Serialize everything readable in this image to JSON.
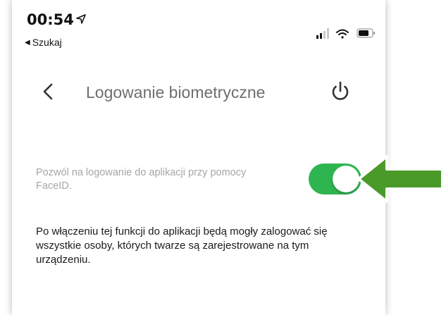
{
  "status_bar": {
    "time": "00:54",
    "back_app_label": "Szukaj"
  },
  "nav": {
    "title": "Logowanie biometryczne"
  },
  "setting": {
    "label": "Pozwól na logowanie do aplikacji przy pomocy FaceID.",
    "enabled": true,
    "toggle_color": "#2fb550"
  },
  "info_text": "Po włączeniu tej funkcji do aplikacji będą mogły zalogować się wszystkie osoby, których twarze są zarejestrowane na tym urządzeniu.",
  "annotation": {
    "arrow_color": "#4a9a2a"
  }
}
